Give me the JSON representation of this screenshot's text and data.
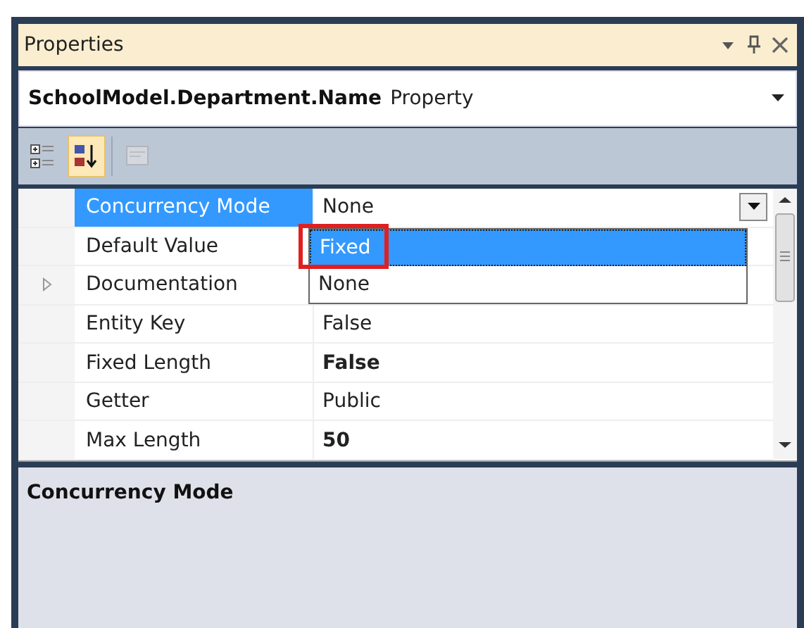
{
  "window": {
    "title": "Properties"
  },
  "object_selector": {
    "name": "SchoolModel.Department.Name",
    "type": "Property"
  },
  "toolbar": [
    {
      "kind": "categorized",
      "selected": false
    },
    {
      "kind": "alphabetical",
      "selected": true
    },
    {
      "kind": "pages",
      "selected": false,
      "disabled": true
    }
  ],
  "grid": {
    "rows": [
      {
        "name": "Concurrency Mode",
        "value": "None",
        "selected": true,
        "editing": true
      },
      {
        "name": "Default Value",
        "selected": false
      },
      {
        "name": "Documentation",
        "selected": false,
        "expandable": true
      },
      {
        "name": "Entity Key",
        "value": "False",
        "selected": false
      },
      {
        "name": "Fixed Length",
        "value": "False",
        "selected": false,
        "modified": true
      },
      {
        "name": "Getter",
        "value": "Public",
        "selected": false
      },
      {
        "name": "Max Length",
        "value": "50",
        "selected": false,
        "modified": true
      }
    ],
    "dropdown": [
      {
        "label": "Fixed",
        "selected": true,
        "highlighted": true
      },
      {
        "label": "None",
        "selected": false,
        "highlighted": false
      }
    ]
  },
  "description": {
    "title": "Concurrency Mode"
  }
}
